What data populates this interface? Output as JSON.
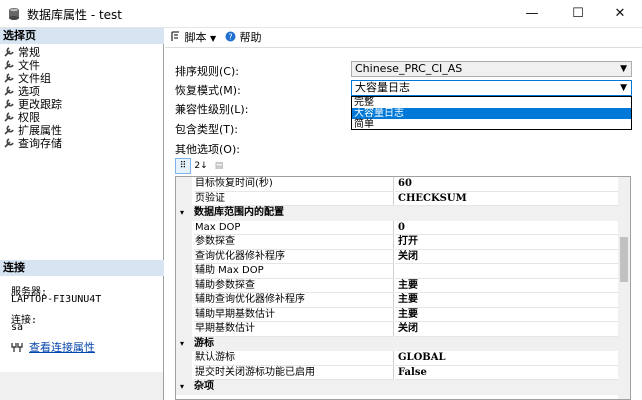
{
  "window": {
    "title": "数据库属性 - test",
    "minimize": "—",
    "maximize": "☐",
    "close": "✕"
  },
  "left_panel": {
    "pages_header": "选择页",
    "pages": [
      "常规",
      "文件",
      "文件组",
      "选项",
      "更改跟踪",
      "权限",
      "扩展属性",
      "查询存储"
    ],
    "connection_header": "连接",
    "server_label": "服务器:",
    "server_value": "LAPTOP-FI3UNU4T",
    "connection_label": "连接:",
    "connection_value": "sa",
    "view_link": "查看连接属性"
  },
  "toolbar": {
    "script_label": "脚本",
    "help_label": "帮助"
  },
  "form": {
    "collation_label": "排序规则(C):",
    "collation_value": "Chinese_PRC_CI_AS",
    "recovery_label": "恢复模式(M):",
    "recovery_value": "大容量日志",
    "compat_label": "兼容性级别(L):",
    "containment_label": "包含类型(T):",
    "other_label": "其他选项(O):",
    "dropdown_options": [
      "完整",
      "大容量日志",
      "简单"
    ],
    "dropdown_selected_index": 1
  },
  "grid_tools": {
    "categorized": "⠿",
    "alphabetical": "2↓",
    "pages": "▤"
  },
  "grid": {
    "rows": [
      {
        "kind": "prop",
        "name": "目标恢复时间(秒)",
        "value": "60"
      },
      {
        "kind": "prop",
        "name": "页验证",
        "value": "CHECKSUM"
      },
      {
        "kind": "cat",
        "name": "数据库范围内的配置",
        "toggle": "▾"
      },
      {
        "kind": "prop",
        "name": "Max DOP",
        "value": "0"
      },
      {
        "kind": "prop",
        "name": "参数探查",
        "value": "打开"
      },
      {
        "kind": "prop",
        "name": "查询优化器修补程序",
        "value": "关闭"
      },
      {
        "kind": "prop",
        "name": "辅助 Max DOP",
        "value": ""
      },
      {
        "kind": "prop",
        "name": "辅助参数探查",
        "value": "主要"
      },
      {
        "kind": "prop",
        "name": "辅助查询优化器修补程序",
        "value": "主要"
      },
      {
        "kind": "prop",
        "name": "辅助早期基数估计",
        "value": "主要"
      },
      {
        "kind": "prop",
        "name": "早期基数估计",
        "value": "关闭"
      },
      {
        "kind": "cat",
        "name": "游标",
        "toggle": "▾"
      },
      {
        "kind": "prop",
        "name": "默认游标",
        "value": "GLOBAL"
      },
      {
        "kind": "prop",
        "name": "提交时关闭游标功能已启用",
        "value": "False"
      },
      {
        "kind": "cat",
        "name": "杂项",
        "toggle": "▾"
      }
    ]
  }
}
